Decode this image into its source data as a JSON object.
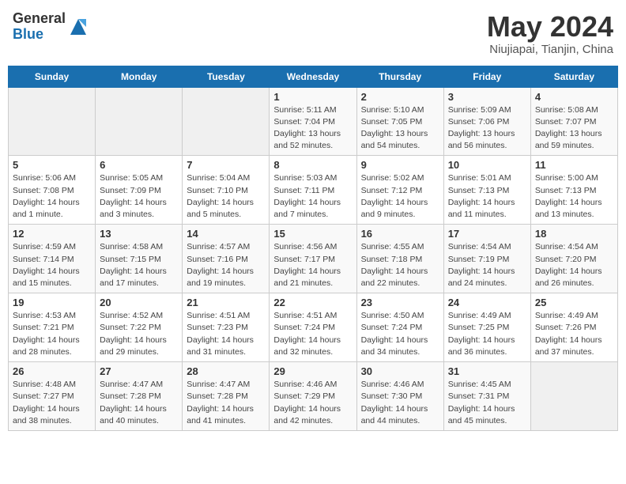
{
  "header": {
    "logo_general": "General",
    "logo_blue": "Blue",
    "month_title": "May 2024",
    "location": "Niujiapai, Tianjin, China"
  },
  "calendar": {
    "days_of_week": [
      "Sunday",
      "Monday",
      "Tuesday",
      "Wednesday",
      "Thursday",
      "Friday",
      "Saturday"
    ],
    "weeks": [
      [
        {
          "day": null,
          "sunrise": null,
          "sunset": null,
          "daylight": null
        },
        {
          "day": null,
          "sunrise": null,
          "sunset": null,
          "daylight": null
        },
        {
          "day": null,
          "sunrise": null,
          "sunset": null,
          "daylight": null
        },
        {
          "day": "1",
          "sunrise": "5:11 AM",
          "sunset": "7:04 PM",
          "daylight": "13 hours and 52 minutes."
        },
        {
          "day": "2",
          "sunrise": "5:10 AM",
          "sunset": "7:05 PM",
          "daylight": "13 hours and 54 minutes."
        },
        {
          "day": "3",
          "sunrise": "5:09 AM",
          "sunset": "7:06 PM",
          "daylight": "13 hours and 56 minutes."
        },
        {
          "day": "4",
          "sunrise": "5:08 AM",
          "sunset": "7:07 PM",
          "daylight": "13 hours and 59 minutes."
        }
      ],
      [
        {
          "day": "5",
          "sunrise": "5:06 AM",
          "sunset": "7:08 PM",
          "daylight": "14 hours and 1 minute."
        },
        {
          "day": "6",
          "sunrise": "5:05 AM",
          "sunset": "7:09 PM",
          "daylight": "14 hours and 3 minutes."
        },
        {
          "day": "7",
          "sunrise": "5:04 AM",
          "sunset": "7:10 PM",
          "daylight": "14 hours and 5 minutes."
        },
        {
          "day": "8",
          "sunrise": "5:03 AM",
          "sunset": "7:11 PM",
          "daylight": "14 hours and 7 minutes."
        },
        {
          "day": "9",
          "sunrise": "5:02 AM",
          "sunset": "7:12 PM",
          "daylight": "14 hours and 9 minutes."
        },
        {
          "day": "10",
          "sunrise": "5:01 AM",
          "sunset": "7:13 PM",
          "daylight": "14 hours and 11 minutes."
        },
        {
          "day": "11",
          "sunrise": "5:00 AM",
          "sunset": "7:13 PM",
          "daylight": "14 hours and 13 minutes."
        }
      ],
      [
        {
          "day": "12",
          "sunrise": "4:59 AM",
          "sunset": "7:14 PM",
          "daylight": "14 hours and 15 minutes."
        },
        {
          "day": "13",
          "sunrise": "4:58 AM",
          "sunset": "7:15 PM",
          "daylight": "14 hours and 17 minutes."
        },
        {
          "day": "14",
          "sunrise": "4:57 AM",
          "sunset": "7:16 PM",
          "daylight": "14 hours and 19 minutes."
        },
        {
          "day": "15",
          "sunrise": "4:56 AM",
          "sunset": "7:17 PM",
          "daylight": "14 hours and 21 minutes."
        },
        {
          "day": "16",
          "sunrise": "4:55 AM",
          "sunset": "7:18 PM",
          "daylight": "14 hours and 22 minutes."
        },
        {
          "day": "17",
          "sunrise": "4:54 AM",
          "sunset": "7:19 PM",
          "daylight": "14 hours and 24 minutes."
        },
        {
          "day": "18",
          "sunrise": "4:54 AM",
          "sunset": "7:20 PM",
          "daylight": "14 hours and 26 minutes."
        }
      ],
      [
        {
          "day": "19",
          "sunrise": "4:53 AM",
          "sunset": "7:21 PM",
          "daylight": "14 hours and 28 minutes."
        },
        {
          "day": "20",
          "sunrise": "4:52 AM",
          "sunset": "7:22 PM",
          "daylight": "14 hours and 29 minutes."
        },
        {
          "day": "21",
          "sunrise": "4:51 AM",
          "sunset": "7:23 PM",
          "daylight": "14 hours and 31 minutes."
        },
        {
          "day": "22",
          "sunrise": "4:51 AM",
          "sunset": "7:24 PM",
          "daylight": "14 hours and 32 minutes."
        },
        {
          "day": "23",
          "sunrise": "4:50 AM",
          "sunset": "7:24 PM",
          "daylight": "14 hours and 34 minutes."
        },
        {
          "day": "24",
          "sunrise": "4:49 AM",
          "sunset": "7:25 PM",
          "daylight": "14 hours and 36 minutes."
        },
        {
          "day": "25",
          "sunrise": "4:49 AM",
          "sunset": "7:26 PM",
          "daylight": "14 hours and 37 minutes."
        }
      ],
      [
        {
          "day": "26",
          "sunrise": "4:48 AM",
          "sunset": "7:27 PM",
          "daylight": "14 hours and 38 minutes."
        },
        {
          "day": "27",
          "sunrise": "4:47 AM",
          "sunset": "7:28 PM",
          "daylight": "14 hours and 40 minutes."
        },
        {
          "day": "28",
          "sunrise": "4:47 AM",
          "sunset": "7:28 PM",
          "daylight": "14 hours and 41 minutes."
        },
        {
          "day": "29",
          "sunrise": "4:46 AM",
          "sunset": "7:29 PM",
          "daylight": "14 hours and 42 minutes."
        },
        {
          "day": "30",
          "sunrise": "4:46 AM",
          "sunset": "7:30 PM",
          "daylight": "14 hours and 44 minutes."
        },
        {
          "day": "31",
          "sunrise": "4:45 AM",
          "sunset": "7:31 PM",
          "daylight": "14 hours and 45 minutes."
        },
        {
          "day": null,
          "sunrise": null,
          "sunset": null,
          "daylight": null
        }
      ]
    ]
  }
}
